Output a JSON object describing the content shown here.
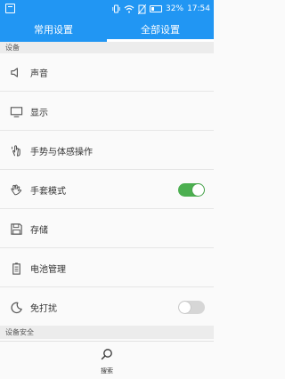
{
  "status_bar": {
    "battery": "32%",
    "time": "17:54"
  },
  "tabs": [
    {
      "label": "常用设置",
      "active": false
    },
    {
      "label": "全部设置",
      "active": true
    }
  ],
  "sections": {
    "device": "设备",
    "device_security": "设备安全"
  },
  "items": [
    {
      "label": "声音",
      "icon": "speaker-icon"
    },
    {
      "label": "显示",
      "icon": "monitor-icon"
    },
    {
      "label": "手势与体感操作",
      "icon": "hand-gesture-icon"
    },
    {
      "label": "手套模式",
      "icon": "glove-icon",
      "toggle": "on"
    },
    {
      "label": "存储",
      "icon": "floppy-disk-icon"
    },
    {
      "label": "电池管理",
      "icon": "battery-icon"
    },
    {
      "label": "免打扰",
      "icon": "moon-icon",
      "toggle": "off"
    }
  ],
  "bottom": {
    "search_label": "搜索"
  },
  "colors": {
    "accent": "#2196f3",
    "toggle_on": "#4caf50"
  }
}
